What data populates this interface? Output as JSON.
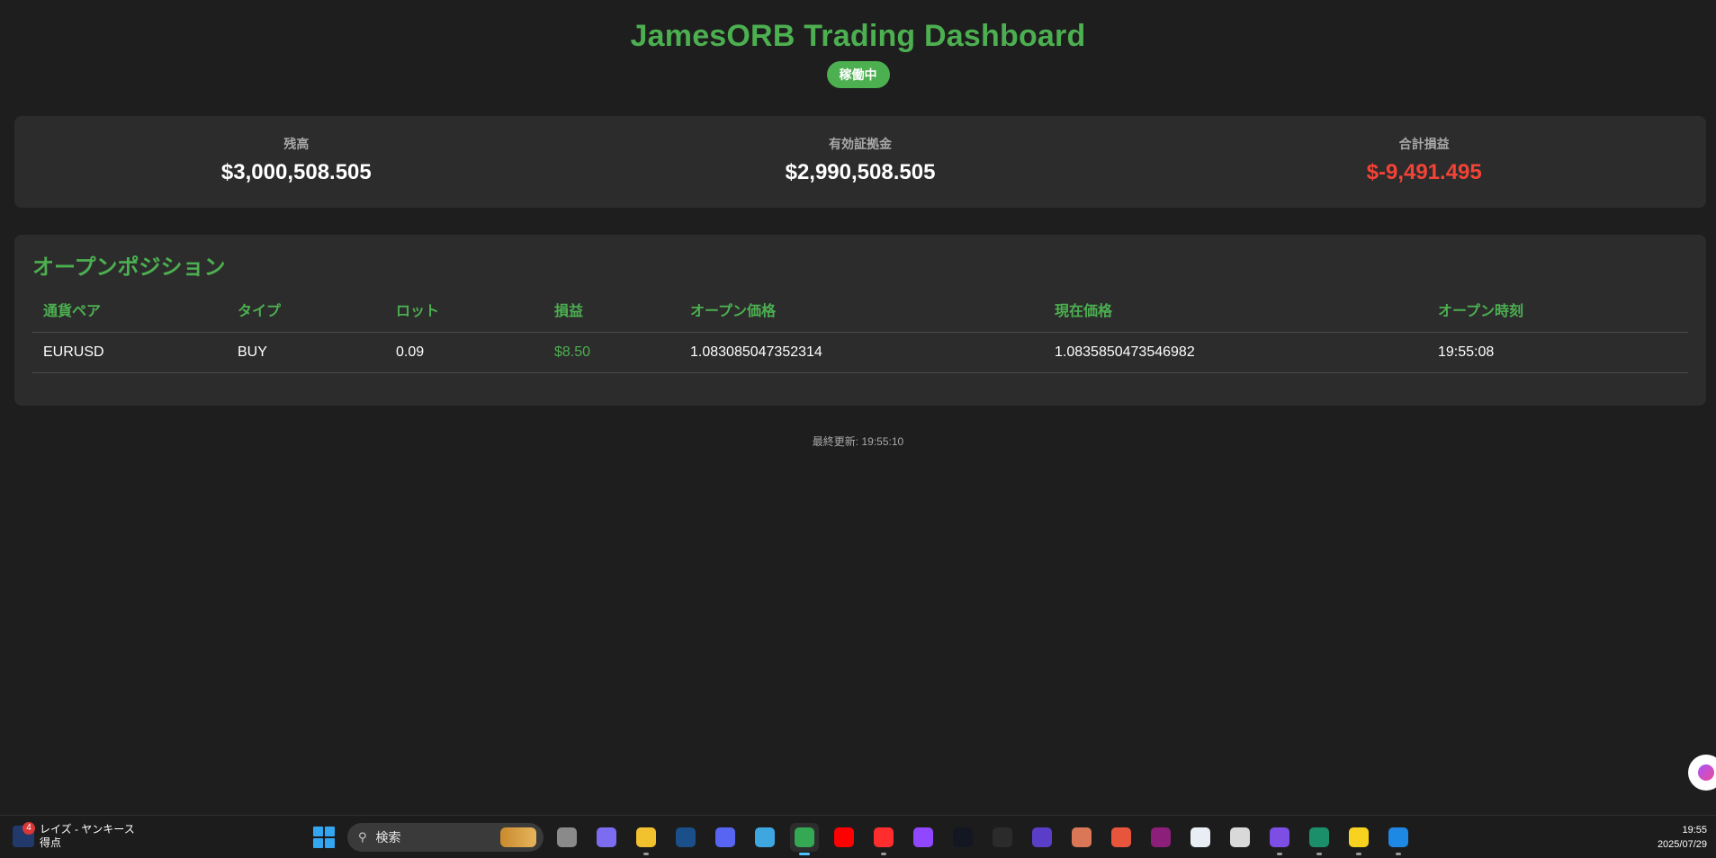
{
  "header": {
    "title": "JamesORB Trading Dashboard",
    "status": "稼働中"
  },
  "summary": [
    {
      "label": "残高",
      "value": "$3,000,508.505"
    },
    {
      "label": "有効証拠金",
      "value": "$2,990,508.505"
    },
    {
      "label": "合計損益",
      "value": "$-9,491.495"
    }
  ],
  "positions": {
    "title": "オープンポジション",
    "columns": [
      "通貨ペア",
      "タイプ",
      "ロット",
      "損益",
      "オープン価格",
      "現在価格",
      "オープン時刻"
    ],
    "rows": [
      [
        "EURUSD",
        "BUY",
        "0.09",
        "$8.50",
        "1.083085047352314",
        "1.0835850473546982",
        "19:55:08"
      ]
    ]
  },
  "footer": {
    "last_updated": "最終更新: 19:55:10"
  },
  "taskbar": {
    "weather_badge": "4",
    "weather_line1": "レイズ - ヤンキース",
    "weather_line2": "得点",
    "search_placeholder": "検索",
    "clock_time": "19:55",
    "clock_date": "2025/07/29",
    "apps": [
      {
        "name": "task-view-icon",
        "color": "#8a8a8a",
        "running": false
      },
      {
        "name": "copilot-icon",
        "color": "#7b6cf0",
        "running": false
      },
      {
        "name": "file-explorer-icon",
        "color": "#f2c12e",
        "running": true
      },
      {
        "name": "steam-icon",
        "color": "#1b4f8a",
        "running": false
      },
      {
        "name": "discord-icon",
        "color": "#5865f2",
        "running": false
      },
      {
        "name": "photos-icon",
        "color": "#3ea7e0",
        "running": false
      },
      {
        "name": "chrome-icon",
        "color": "#34a853",
        "running": true,
        "active": true
      },
      {
        "name": "youtube-music-icon",
        "color": "#ff0000",
        "running": false
      },
      {
        "name": "youtube-icon",
        "color": "#ff2d2d",
        "running": true
      },
      {
        "name": "twitch-icon",
        "color": "#9146ff",
        "running": false
      },
      {
        "name": "tradingview-icon",
        "color": "#131722",
        "running": false
      },
      {
        "name": "calculator-icon",
        "color": "#2b2b2b",
        "running": false
      },
      {
        "name": "playstation-icon",
        "color": "#5b3ec8",
        "running": false
      },
      {
        "name": "claude-icon",
        "color": "#d97757",
        "running": false
      },
      {
        "name": "notes-icon",
        "color": "#e8553d",
        "running": false
      },
      {
        "name": "powershell-icon",
        "color": "#8b1f7a",
        "running": false
      },
      {
        "name": "app-store-icon",
        "color": "#e9eef5",
        "running": false
      },
      {
        "name": "chatgpt-icon",
        "color": "#d9d9d9",
        "running": false
      },
      {
        "name": "assistant-icon",
        "color": "#7c4ee4",
        "running": true
      },
      {
        "name": "metatrader-icon",
        "color": "#1b8f6a",
        "running": true
      },
      {
        "name": "sticky-notes-icon",
        "color": "#f7d21e",
        "running": true
      },
      {
        "name": "vscode-icon",
        "color": "#1e88e5",
        "running": true
      }
    ]
  }
}
